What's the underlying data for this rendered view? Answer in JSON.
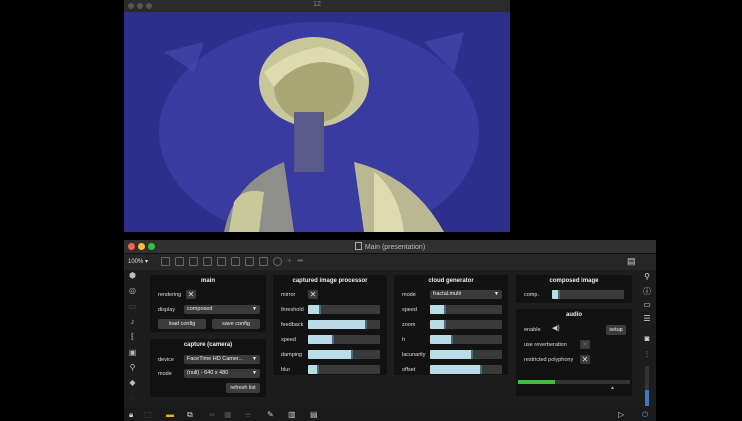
{
  "video_window": {
    "title": "12"
  },
  "main_window": {
    "title": "Main (presentation)",
    "zoom": "100% ▾"
  },
  "panels": {
    "main": {
      "title": "main",
      "rendering_label": "rendering",
      "display_label": "display",
      "display_value": "composed",
      "load_config": "load config",
      "save_config": "save config"
    },
    "capture": {
      "title": "capture (camera)",
      "device_label": "device",
      "device_value": "FaceTime HD Camer...",
      "mode_label": "mode",
      "mode_value": "(null) - 640 x 480",
      "refresh_list": "refresh list"
    },
    "processor": {
      "title": "captured image processor",
      "mirror_label": "mirror",
      "sliders": [
        {
          "label": "threshold",
          "value": 0.18
        },
        {
          "label": "feedback",
          "value": 0.82
        },
        {
          "label": "speed",
          "value": 0.36
        },
        {
          "label": "damping",
          "value": 0.62
        },
        {
          "label": "blur",
          "value": 0.15
        }
      ]
    },
    "cloud": {
      "title": "cloud generator",
      "mode_label": "mode",
      "mode_value": "fractal.multi",
      "sliders": [
        {
          "label": "speed",
          "value": 0.22
        },
        {
          "label": "zoom",
          "value": 0.22
        },
        {
          "label": "h",
          "value": 0.32
        },
        {
          "label": "lacunarity",
          "value": 0.6
        },
        {
          "label": "offset",
          "value": 0.72
        }
      ]
    },
    "composed": {
      "title": "composed image",
      "comp_label": "comp.",
      "comp_value": 0.07
    },
    "audio": {
      "title": "audio",
      "enable_label": "enable",
      "setup": "setup",
      "reverb_label": "use reverberation",
      "polyphony_label": "restricted polyphony",
      "level": 0.33
    }
  },
  "colors": {
    "video_tint": "#2e2f8c",
    "slider_fill": "#b9dce6",
    "meter_green": "#3fbf3f"
  },
  "icons": {
    "close": "✕",
    "speaker": "🔈",
    "chevron": "▾"
  }
}
